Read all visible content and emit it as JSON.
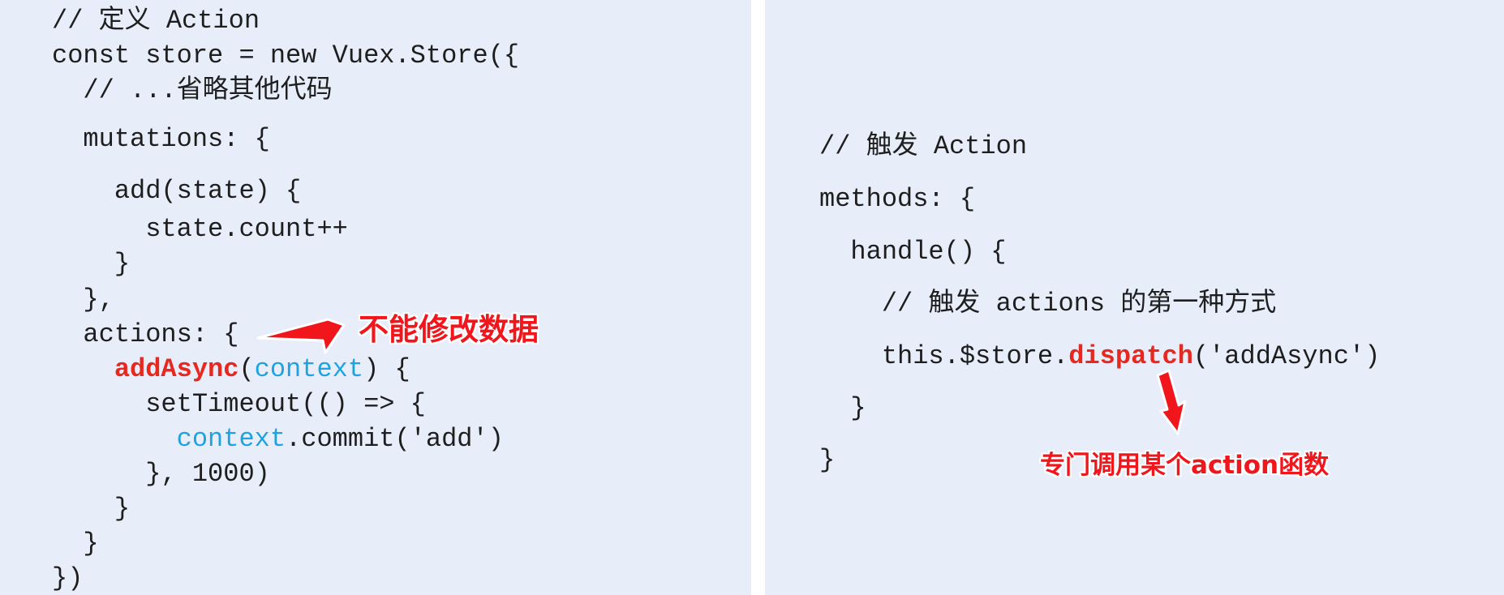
{
  "left_code": {
    "l1": "// 定义 Action",
    "l2": "const store = new Vuex.Store({",
    "l3": "  // ...省略其他代码",
    "l4": "  mutations: {",
    "l5": "    add(state) {",
    "l6": "      state.count++",
    "l7": "    }",
    "l8": "  },",
    "l9": "  actions: {",
    "l10_indent": "    ",
    "l10_func": "addAsync",
    "l10_open": "(",
    "l10_param": "context",
    "l10_close": ") {",
    "l11": "      setTimeout(() => {",
    "l12_indent": "        ",
    "l12_obj": "context",
    "l12_rest": ".commit('add')",
    "l13": "      }, 1000)",
    "l14": "    }",
    "l15": "  }",
    "l16": "})"
  },
  "right_code": {
    "l1": "// 触发 Action",
    "l2": "methods: {",
    "l3": "  handle() {",
    "l4": "    // 触发 actions 的第一种方式",
    "l5_pre": "    this.$store.",
    "l5_func": "dispatch",
    "l5_post": "('addAsync')",
    "l6": "  }",
    "l7": "}"
  },
  "annotations": {
    "left": "不能修改数据",
    "right": "专门调用某个action函数"
  },
  "colors": {
    "panel_bg": "#e7eefa",
    "code_text": "#1e1e1e",
    "highlight_red": "#e8271f",
    "highlight_blue": "#1fa3e0",
    "arrow_red": "#f0161b"
  }
}
